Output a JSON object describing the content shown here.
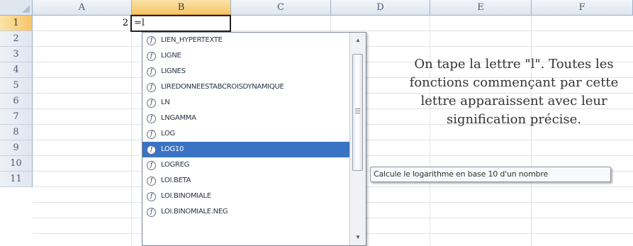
{
  "columns": [
    "A",
    "B",
    "C",
    "D",
    "E",
    "F"
  ],
  "rows": [
    "1",
    "2",
    "3",
    "4",
    "5",
    "6",
    "7",
    "8",
    "9",
    "10",
    "11"
  ],
  "selected_column": "B",
  "selected_row": "1",
  "cells": {
    "A1": "2",
    "B1": "=l"
  },
  "autocomplete": {
    "items": [
      "LIEN_HYPERTEXTE",
      "LIGNE",
      "LIGNES",
      "LIREDONNEESTABCROISDYNAMIQUE",
      "LN",
      "LNGAMMA",
      "LOG",
      "LOG10",
      "LOGREG",
      "LOI.BETA",
      "LOI.BINOMIALE",
      "LOI.BINOMIALE.NEG"
    ],
    "selected_index": 7,
    "function_icon": "function-icon"
  },
  "tooltip": "Calcule le logarithme en base 10 d'un nombre",
  "annotation": "On tape la lettre \"l\". Toutes les fonctions commençant par cette lettre apparaissent avec leur signification précise.",
  "colors": {
    "selection_blue": "#3b73c4",
    "header_highlight": "#f6c567",
    "header_bg": "#dfe6ef"
  }
}
